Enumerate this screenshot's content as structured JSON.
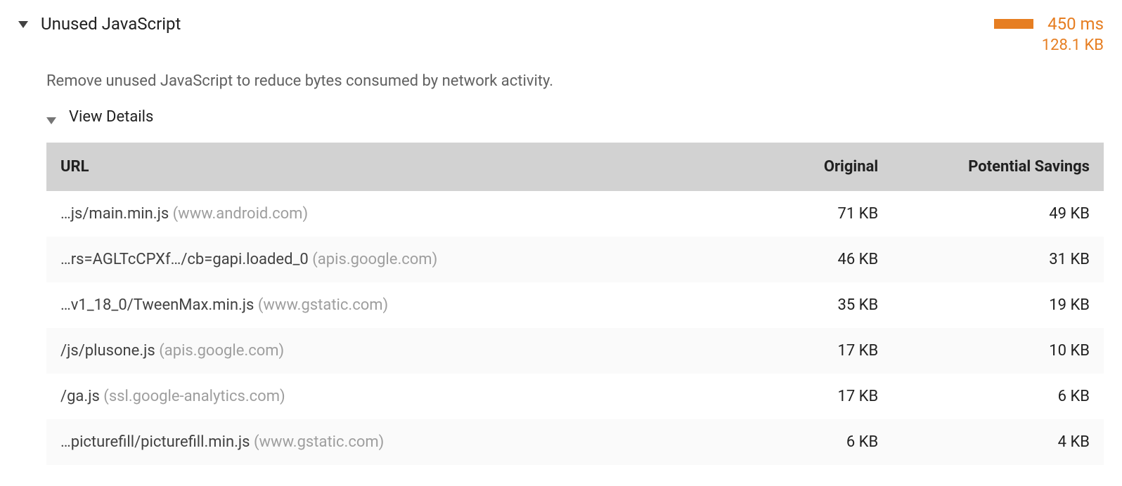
{
  "audit": {
    "title": "Unused JavaScript",
    "time": "450 ms",
    "size": "128.1 KB",
    "description": "Remove unused JavaScript to reduce bytes consumed by network activity."
  },
  "details": {
    "label": "View Details"
  },
  "table": {
    "headers": {
      "url": "URL",
      "original": "Original",
      "savings": "Potential Savings"
    },
    "rows": [
      {
        "path": "…js/main.min.js",
        "host": "(www.android.com)",
        "original": "71 KB",
        "savings": "49 KB"
      },
      {
        "path": "…rs=AGLTcCPXf…/cb=gapi.loaded_0",
        "host": "(apis.google.com)",
        "original": "46 KB",
        "savings": "31 KB"
      },
      {
        "path": "…v1_18_0/TweenMax.min.js",
        "host": "(www.gstatic.com)",
        "original": "35 KB",
        "savings": "19 KB"
      },
      {
        "path": "/js/plusone.js",
        "host": "(apis.google.com)",
        "original": "17 KB",
        "savings": "10 KB"
      },
      {
        "path": "/ga.js",
        "host": "(ssl.google-analytics.com)",
        "original": "17 KB",
        "savings": "6 KB"
      },
      {
        "path": "…picturefill/picturefill.min.js",
        "host": "(www.gstatic.com)",
        "original": "6 KB",
        "savings": "4 KB"
      }
    ]
  }
}
